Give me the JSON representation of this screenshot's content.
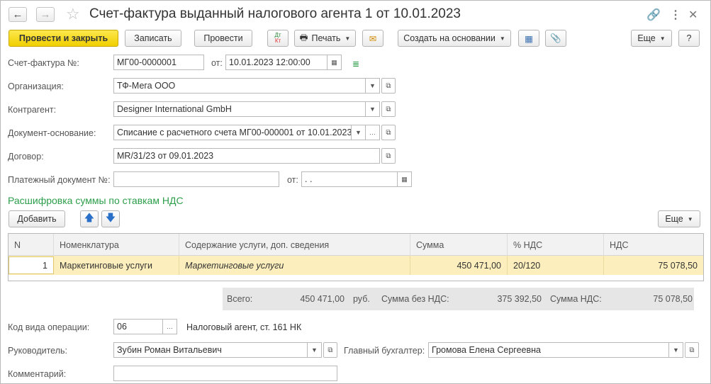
{
  "window": {
    "title": "Счет-фактура выданный налогового агента 1 от 10.01.2023",
    "back_icon": "arrow-left",
    "forward_icon": "arrow-right",
    "star_icon": "star-outline",
    "link_icon": "link",
    "menu_icon": "vertical-dots",
    "close_icon": "close-x"
  },
  "toolbar": {
    "post_close": "Провести и закрыть",
    "save": "Записать",
    "post": "Провести",
    "dt_kt": "Дт Кт",
    "print": "Печать",
    "create_based": "Создать на основании",
    "more": "Еще",
    "help": "?"
  },
  "form": {
    "invoice_label": "Счет-фактура №:",
    "invoice_number": "МГ00-0000001",
    "from_label": "от:",
    "invoice_date": "10.01.2023 12:00:00",
    "org_label": "Организация:",
    "org_value": "ТФ-Мега ООО",
    "contractor_label": "Контрагент:",
    "contractor_value": "Designer International GmbH",
    "basis_label": "Документ-основание:",
    "basis_value": "Списание с расчетного счета МГ00-000001 от 10.01.2023",
    "contract_label": "Договор:",
    "contract_value": "MR/31/23 от 09.01.2023",
    "payment_label": "Платежный документ №:",
    "payment_value": "",
    "payment_from_label": "от:",
    "payment_date": " .  .",
    "section_title": "Расшифровка суммы по ставкам НДС"
  },
  "table_toolbar": {
    "add": "Добавить",
    "more": "Еще"
  },
  "table": {
    "columns": [
      "N",
      "Номенклатура",
      "Содержание услуги, доп. сведения",
      "Сумма",
      "% НДС",
      "НДС"
    ],
    "rows": [
      {
        "n": "1",
        "item": "Маркетинговые услуги",
        "content": "Маркетинговые услуги",
        "sum": "450 471,00",
        "vat_rate": "20/120",
        "vat": "75 078,50"
      }
    ]
  },
  "totals": {
    "total_label": "Всего:",
    "total_value": "450 471,00",
    "currency": "руб.",
    "novat_label": "Сумма без НДС:",
    "novat_value": "375 392,50",
    "vat_label": "Сумма НДС:",
    "vat_value": "75 078,50"
  },
  "footer": {
    "op_code_label": "Код вида операции:",
    "op_code_value": "06",
    "op_code_desc": "Налоговый агент, ст. 161 НК",
    "head_label": "Руководитель:",
    "head_value": "Зубин Роман Витальевич",
    "accountant_label": "Главный бухгалтер:",
    "accountant_value": "Громова Елена Сергеевна",
    "comment_label": "Комментарий:",
    "comment_value": ""
  }
}
